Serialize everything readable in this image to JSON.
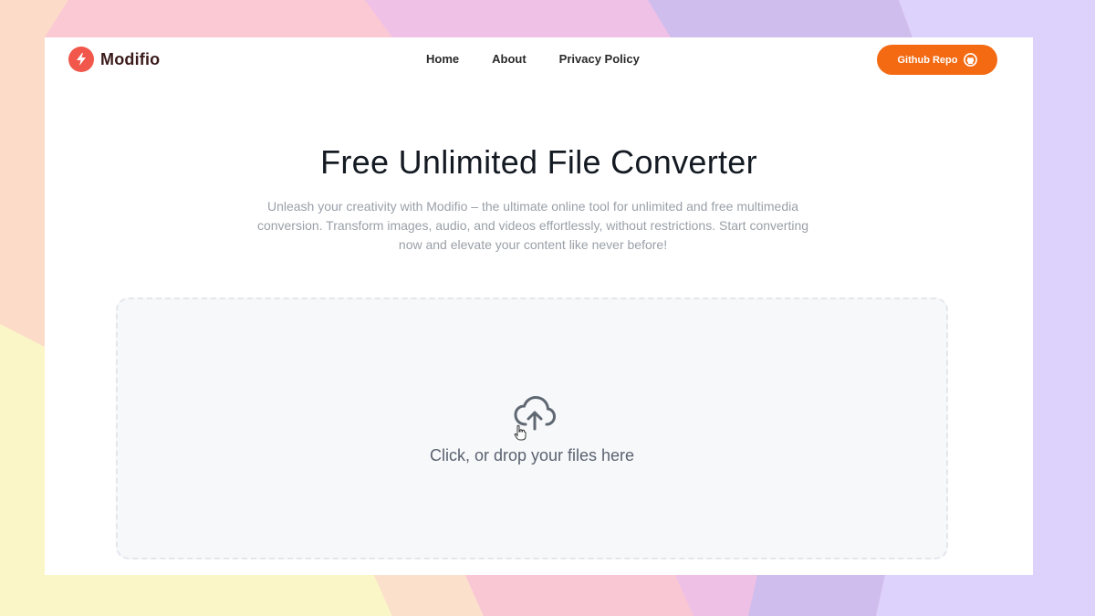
{
  "app": {
    "brand_name": "Modifio",
    "brand_color": "#f1574b",
    "accent_color": "#f36a13"
  },
  "nav": {
    "links": [
      {
        "label": "Home"
      },
      {
        "label": "About"
      },
      {
        "label": "Privacy Policy"
      }
    ],
    "github_button": {
      "label": "Github Repo",
      "icon": "github-icon"
    }
  },
  "hero": {
    "title": "Free Unlimited File Converter",
    "subtitle": "Unleash your creativity with Modifio – the ultimate online tool for unlimited and free multimedia conversion. Transform images, audio, and videos effortlessly, without restrictions. Start converting now and elevate your content like never before!"
  },
  "dropzone": {
    "label": "Click, or drop your files here",
    "icon": "cloud-upload-icon"
  }
}
